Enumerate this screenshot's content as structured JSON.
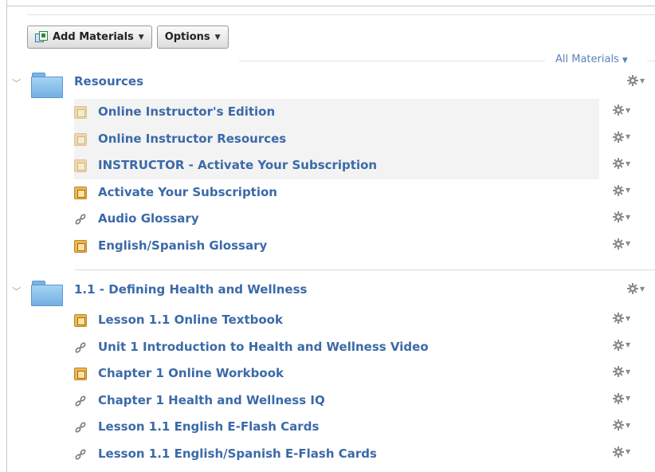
{
  "toolbar": {
    "add_materials_label": "Add Materials",
    "options_label": "Options"
  },
  "filter": {
    "label": "All Materials"
  },
  "icons": {
    "gear": "gear-icon",
    "folder": "folder-icon",
    "book": "book-icon",
    "link": "link-icon",
    "collapse": "chevron-down-icon"
  },
  "colors": {
    "link_text": "#3b6aa8",
    "folder": "#73afe3",
    "book": "#f0b64c"
  },
  "sections": [
    {
      "title": "Resources",
      "items": [
        {
          "label": "Online Instructor's Edition",
          "icon": "book",
          "faded": true
        },
        {
          "label": "Online Instructor Resources",
          "icon": "book",
          "faded": true
        },
        {
          "label": "INSTRUCTOR - Activate Your Subscription",
          "icon": "book",
          "faded": true
        },
        {
          "label": "Activate Your Subscription",
          "icon": "book",
          "faded": false
        },
        {
          "label": "Audio Glossary",
          "icon": "link",
          "faded": false
        },
        {
          "label": "English/Spanish Glossary",
          "icon": "book",
          "faded": false
        }
      ]
    },
    {
      "title": "1.1 - Defining Health and Wellness",
      "items": [
        {
          "label": "Lesson 1.1 Online Textbook",
          "icon": "book",
          "faded": false
        },
        {
          "label": "Unit 1 Introduction to Health and Wellness Video",
          "icon": "link",
          "faded": false
        },
        {
          "label": "Chapter 1 Online Workbook",
          "icon": "book",
          "faded": false
        },
        {
          "label": "Chapter 1 Health and Wellness IQ",
          "icon": "link",
          "faded": false
        },
        {
          "label": "Lesson 1.1 English E-Flash Cards",
          "icon": "link",
          "faded": false
        },
        {
          "label": "Lesson 1.1 English/Spanish E-Flash Cards",
          "icon": "link",
          "faded": false
        }
      ]
    }
  ]
}
